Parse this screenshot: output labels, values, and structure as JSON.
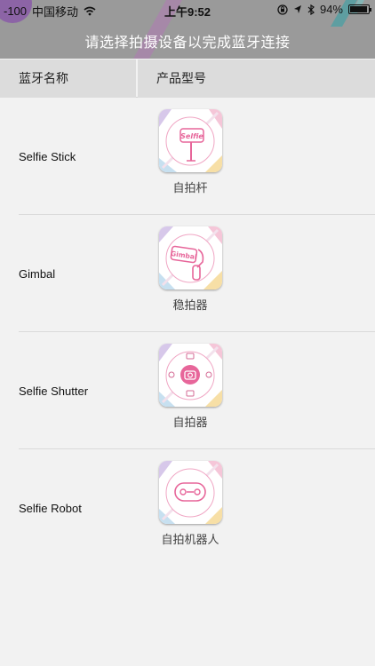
{
  "status_bar": {
    "signal": "-100",
    "carrier": "中国移动",
    "time": "上午9:52",
    "battery": "94%",
    "battery_level": 0.94
  },
  "header": {
    "title": "请选择拍摄设备以完成蓝牙连接"
  },
  "table": {
    "col_name": "蓝牙名称",
    "col_model": "产品型号"
  },
  "devices": [
    {
      "name": "Selfie Stick",
      "caption": "自拍杆",
      "icon": "selfie-stick-icon",
      "icon_text": "Selfie"
    },
    {
      "name": "Gimbal",
      "caption": "稳拍器",
      "icon": "gimbal-icon",
      "icon_text": "Gimbal"
    },
    {
      "name": "Selfie Shutter",
      "caption": "自拍器",
      "icon": "selfie-shutter-icon"
    },
    {
      "name": "Selfie Robot",
      "caption": "自拍机器人",
      "icon": "selfie-robot-icon"
    }
  ],
  "colors": {
    "header_bg": "#9a9a9a",
    "accent_pink": "#e7669a",
    "accent_purple": "#8a5aa8",
    "page_bg": "#f2f2f2"
  }
}
